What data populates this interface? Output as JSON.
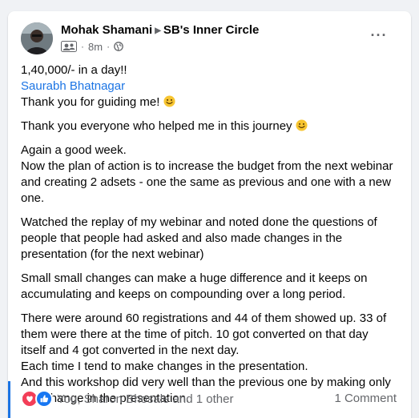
{
  "post": {
    "author": "Mohak Shamani",
    "group": "SB's Inner Circle",
    "time": "8m",
    "more_icon": "more-horizontal-icon",
    "members_icon": "group-members-icon",
    "audience_icon": "globe-icon",
    "paragraphs": [
      {
        "lines": [
          "1,40,000/- in a day!!"
        ]
      },
      {
        "mention": "Saurabh Bhatnagar",
        "after_mention": "Thank you for guiding me!",
        "emoji": "smiley-emoji"
      },
      {
        "text": "Thank you everyone who helped me in this journey",
        "emoji": "smiley-emoji"
      },
      {
        "lines": [
          "Again a good week.",
          "Now the plan of action is to increase the budget from the next webinar and creating 2 adsets - one the same as previous and one with a new one."
        ]
      },
      {
        "lines": [
          "Watched the replay of my webinar and noted done the questions of people that people had asked and also made changes in the presentation (for the next webinar)"
        ]
      },
      {
        "lines": [
          "Small small changes can make a huge difference and it keeps on accumulating and keeps on compounding over a long period."
        ]
      },
      {
        "lines": [
          "There were around 60 registrations and 44 of them showed up. 33 of them were there at the time of pitch. 10 got converted on that day itself and 4 got converted in the next day.",
          "Each time I tend to make changes in the presentation.",
          "And this workshop did very well than the previous one by making only one change in the presentation."
        ]
      }
    ],
    "reactions": {
      "icons": [
        "love-reaction-icon",
        "like-reaction-icon"
      ],
      "text": "You, Sharon Bhosale and 1 other"
    },
    "comments": "1 Comment"
  },
  "colors": {
    "link": "#1b74e4",
    "secondary_text": "#65676b",
    "love": "#f33e58",
    "like": "#1877f2",
    "background": "#f0f2f5"
  }
}
